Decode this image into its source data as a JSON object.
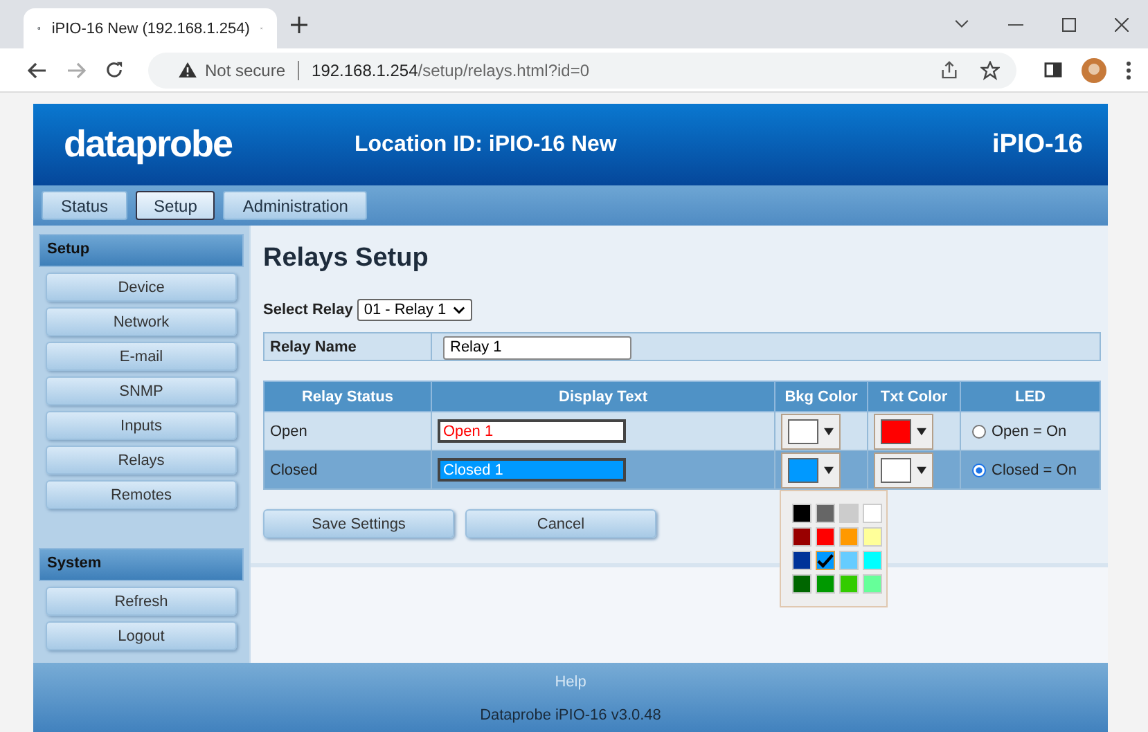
{
  "browser": {
    "tab_title": "iPIO-16 New (192.168.1.254)",
    "security": "Not secure",
    "url_host": "192.168.1.254",
    "url_path": "/setup/relays.html?id=0"
  },
  "header": {
    "logo": "dataprobe",
    "location": "Location ID: iPIO-16 New",
    "model": "iPIO-16"
  },
  "nav": [
    {
      "label": "Status",
      "selected": false
    },
    {
      "label": "Setup",
      "selected": true
    },
    {
      "label": "Administration",
      "selected": false
    }
  ],
  "sidebar": [
    {
      "heading": "Setup",
      "items": [
        "Device",
        "Network",
        "E-mail",
        "SNMP",
        "Inputs",
        "Relays",
        "Remotes"
      ]
    },
    {
      "heading": "System",
      "items": [
        "Refresh",
        "Logout"
      ]
    }
  ],
  "main": {
    "title": "Relays Setup",
    "select_label": "Select Relay",
    "select_value": "01 - Relay 1",
    "name_label": "Relay Name",
    "name_value": "Relay 1",
    "columns": [
      "Relay Status",
      "Display Text",
      "Bkg Color",
      "Txt Color",
      "LED"
    ],
    "rows": [
      {
        "status": "Open",
        "text": "Open 1",
        "bkg": {
          "color": "#ffffff"
        },
        "txt": {
          "color": "#ff0000"
        },
        "led": "Open = On",
        "selected": false
      },
      {
        "status": "Closed",
        "text": "Closed 1",
        "bkg": {
          "color": "#0099ff"
        },
        "txt": {
          "color": "#ffffff"
        },
        "led": "Closed = On",
        "selected": true
      }
    ],
    "palette": [
      {
        "color": "#000000",
        "selected": false
      },
      {
        "color": "#666666",
        "selected": false
      },
      {
        "color": "#cccccc",
        "selected": false
      },
      {
        "color": "#ffffff",
        "selected": false
      },
      {
        "color": "#990000",
        "selected": false
      },
      {
        "color": "#ff0000",
        "selected": false
      },
      {
        "color": "#ff9900",
        "selected": false
      },
      {
        "color": "#ffff99",
        "selected": false
      },
      {
        "color": "#003399",
        "selected": false
      },
      {
        "color": "#0099ff",
        "selected": true
      },
      {
        "color": "#66ccff",
        "selected": false
      },
      {
        "color": "#00ffff",
        "selected": false
      },
      {
        "color": "#006600",
        "selected": false
      },
      {
        "color": "#009900",
        "selected": false
      },
      {
        "color": "#33cc00",
        "selected": false
      },
      {
        "color": "#66ff99",
        "selected": false
      }
    ],
    "buttons": [
      "Save Settings",
      "Cancel"
    ]
  },
  "footer": {
    "link": "Help",
    "version": "Dataprobe iPIO-16 v3.0.48"
  }
}
